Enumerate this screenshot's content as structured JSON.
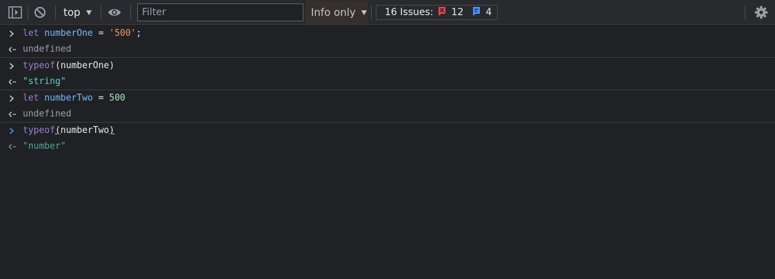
{
  "toolbar": {
    "context": "top",
    "filter_placeholder": "Filter",
    "levels_label": "Info only",
    "issues_label": "16 Issues:",
    "errors_count": "12",
    "info_count": "4"
  },
  "colors": {
    "panel_bg": "#202124",
    "toolbar_bg": "#292a2d",
    "keyword": "#9a7fd5",
    "variable": "#79b8ff",
    "string": "#f29766",
    "number": "#a9e5bb",
    "string_result": "#5cd5c0",
    "error_badge": "#e8434a",
    "info_badge": "#4a8ff5"
  },
  "console": {
    "entries": [
      {
        "input": {
          "kw": "let",
          "var": "numberOne",
          "op": " = ",
          "value": "'500'",
          "end": ";"
        },
        "output": "undefined"
      },
      {
        "input": {
          "kw": "typeof",
          "open": "(",
          "arg": "numberOne",
          "close": ")"
        },
        "output": "\"string\""
      },
      {
        "input": {
          "kw": "let",
          "var": "numberTwo",
          "op": " = ",
          "value": "500"
        },
        "output": "undefined"
      },
      {
        "input": {
          "kw": "typeof",
          "open": "(",
          "arg": "numberTwo",
          "close": ")"
        },
        "output": "\"number\""
      }
    ]
  }
}
